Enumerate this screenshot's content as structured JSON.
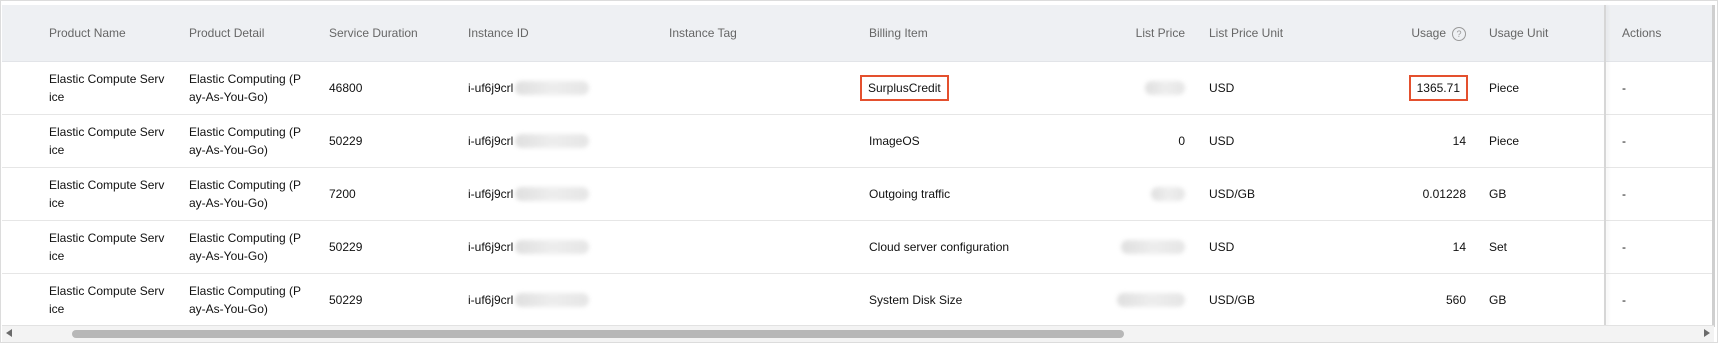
{
  "table": {
    "columns": {
      "product_name": "Product Name",
      "product_detail": "Product Detail",
      "service_duration": "Service Duration",
      "instance_id": "Instance ID",
      "instance_tag": "Instance Tag",
      "billing_item": "Billing Item",
      "list_price": "List Price",
      "list_price_unit": "List Price Unit",
      "usage": "Usage",
      "usage_unit": "Usage Unit",
      "actions": "Actions"
    },
    "usage_help_icon": "help-icon",
    "rows": [
      {
        "product_name": "Elastic Compute Service",
        "product_detail": "Elastic Computing (Pay-As-You-Go)",
        "service_duration": "46800",
        "instance_id_prefix": "i-uf6j9crl",
        "instance_tag": "",
        "billing_item": "SurplusCredit",
        "list_price": "",
        "list_price_unit": "USD",
        "usage": "1365.71",
        "usage_unit": "Piece",
        "actions": "-"
      },
      {
        "product_name": "Elastic Compute Service",
        "product_detail": "Elastic Computing (Pay-As-You-Go)",
        "service_duration": "50229",
        "instance_id_prefix": "i-uf6j9crl",
        "instance_tag": "",
        "billing_item": "ImageOS",
        "list_price": "0",
        "list_price_unit": "USD",
        "usage": "14",
        "usage_unit": "Piece",
        "actions": "-"
      },
      {
        "product_name": "Elastic Compute Service",
        "product_detail": "Elastic Computing (Pay-As-You-Go)",
        "service_duration": "7200",
        "instance_id_prefix": "i-uf6j9crl",
        "instance_tag": "",
        "billing_item": "Outgoing traffic",
        "list_price": "",
        "list_price_unit": "USD/GB",
        "usage": "0.01228",
        "usage_unit": "GB",
        "actions": "-"
      },
      {
        "product_name": "Elastic Compute Service",
        "product_detail": "Elastic Computing (Pay-As-You-Go)",
        "service_duration": "50229",
        "instance_id_prefix": "i-uf6j9crl",
        "instance_tag": "",
        "billing_item": "Cloud server configuration",
        "list_price": "",
        "list_price_unit": "USD",
        "usage": "14",
        "usage_unit": "Set",
        "actions": "-"
      },
      {
        "product_name": "Elastic Compute Service",
        "product_detail": "Elastic Computing (Pay-As-You-Go)",
        "service_duration": "50229",
        "instance_id_prefix": "i-uf6j9crl",
        "instance_tag": "",
        "billing_item": "System Disk Size",
        "list_price": "",
        "list_price_unit": "USD/GB",
        "usage": "560",
        "usage_unit": "GB",
        "actions": "-"
      }
    ]
  },
  "colors": {
    "header_bg": "#eef0f3",
    "highlight_box": "#e4502e",
    "row_border": "#e6e6e6"
  },
  "scrollbar": {
    "left_arrow_icon": "left-arrow-icon",
    "right_arrow_icon": "right-arrow-icon"
  }
}
